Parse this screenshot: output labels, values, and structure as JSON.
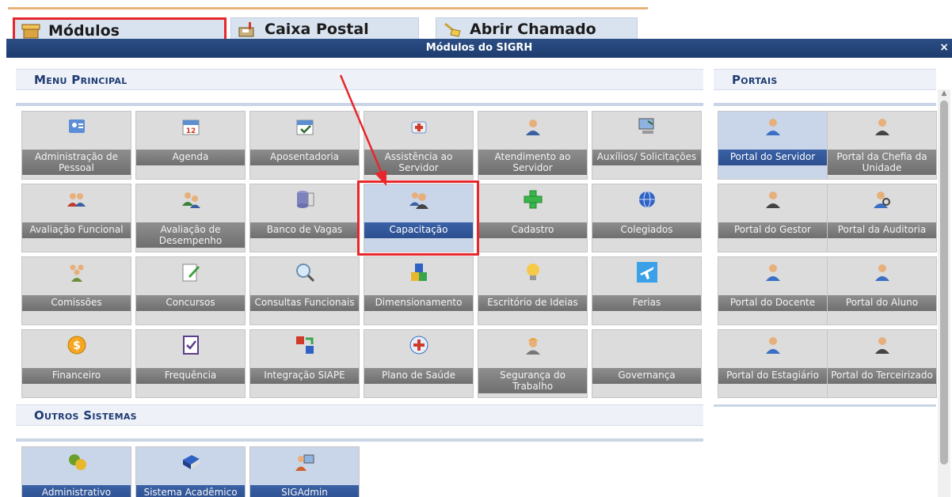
{
  "tabs": {
    "modulos": "Módulos",
    "caixa_postal": "Caixa Postal",
    "abrir_chamado": "Abrir Chamado"
  },
  "modal": {
    "title": "Módulos do SIGRH",
    "close": "×"
  },
  "sections": {
    "menu_principal": "Menu Principal",
    "portais": "Portais",
    "outros_sistemas": "Outros Sistemas"
  },
  "menu_principal": [
    {
      "label": "Administração de Pessoal",
      "icon": "admin-people-icon"
    },
    {
      "label": "Agenda",
      "icon": "calendar-icon"
    },
    {
      "label": "Aposentadoria",
      "icon": "calendar-check-icon"
    },
    {
      "label": "Assistência ao Servidor",
      "icon": "first-aid-icon"
    },
    {
      "label": "Atendimento ao Servidor",
      "icon": "user-support-icon"
    },
    {
      "label": "Auxílios/ Solicitações",
      "icon": "computer-icon"
    },
    {
      "label": "Avaliação Funcional",
      "icon": "users-icon"
    },
    {
      "label": "Avaliação de Desempenho",
      "icon": "users-check-icon"
    },
    {
      "label": "Banco de Vagas",
      "icon": "database-icon"
    },
    {
      "label": "Capacitação",
      "icon": "users-group-icon"
    },
    {
      "label": "Cadastro",
      "icon": "plus-icon"
    },
    {
      "label": "Colegiados",
      "icon": "globe-icon"
    },
    {
      "label": "Comissões",
      "icon": "group-icon"
    },
    {
      "label": "Concursos",
      "icon": "edit-doc-icon"
    },
    {
      "label": "Consultas Funcionais",
      "icon": "magnifier-icon"
    },
    {
      "label": "Dimensionamento",
      "icon": "blocks-icon"
    },
    {
      "label": "Escritório de Ideias",
      "icon": "lightbulb-icon"
    },
    {
      "label": "Ferias",
      "icon": "airplane-icon"
    },
    {
      "label": "Financeiro",
      "icon": "dollar-icon"
    },
    {
      "label": "Frequência",
      "icon": "checklist-icon"
    },
    {
      "label": "Integração SIAPE",
      "icon": "sync-icon"
    },
    {
      "label": "Plano de Saúde",
      "icon": "health-plus-icon"
    },
    {
      "label": "Segurança do Trabalho",
      "icon": "worker-icon"
    },
    {
      "label": "Governança",
      "icon": ""
    }
  ],
  "portais": [
    {
      "label": "Portal do Servidor",
      "icon": "person-icon"
    },
    {
      "label": "Portal da Chefia da Unidade",
      "icon": "person-suit-icon"
    },
    {
      "label": "Portal do Gestor",
      "icon": "person-suit-icon"
    },
    {
      "label": "Portal da Auditoria",
      "icon": "person-search-icon"
    },
    {
      "label": "Portal do Docente",
      "icon": "person-icon"
    },
    {
      "label": "Portal do Aluno",
      "icon": "person-icon"
    },
    {
      "label": "Portal do Estagiário",
      "icon": "person-icon"
    },
    {
      "label": "Portal do Terceirizado",
      "icon": "person-suit-icon"
    }
  ],
  "outros_sistemas": [
    {
      "label": "Administrativo",
      "icon": "admin-system-icon"
    },
    {
      "label": "Sistema Acadêmico",
      "icon": "book-icon"
    },
    {
      "label": "SIGAdmin",
      "icon": "user-computer-icon"
    }
  ],
  "colors": {
    "header": "#1e3b6e",
    "highlight": "#e8262b",
    "active_label": "#2c4f8f",
    "tile_bg": "#dcdcdc",
    "section_text": "#1f3b73"
  }
}
